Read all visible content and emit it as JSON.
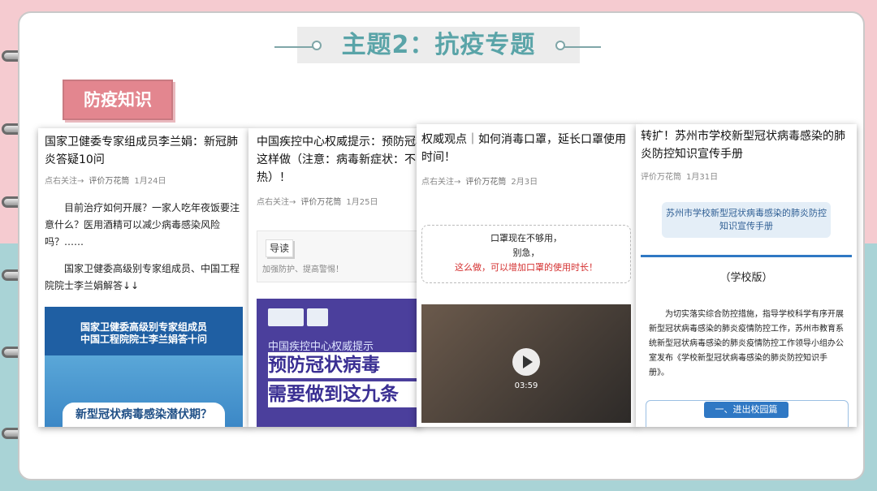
{
  "slide": {
    "title": "主题2：抗疫专题",
    "section_tag": "防疫知识"
  },
  "articles": [
    {
      "title": "国家卫健委专家组成员李兰娟：新冠肺炎答疑10问",
      "follow": "点右关注→",
      "source": "评价万花筒",
      "date": "1月24日",
      "paragraph1": "目前治疗如何开展？一家人吃年夜饭要注意什么？医用酒精可以减少病毒感染风险吗？……",
      "paragraph2": "国家卫健委高级别专家组成员、中国工程院院士李兰娟解答↓↓",
      "banner_line1": "国家卫健委高级别专家组成员",
      "banner_line2": "中国工程院院士李兰娟答十问",
      "callout": "新型冠状病毒感染潜伏期？"
    },
    {
      "title": "中国疾控中心权威提示：预防冠状病毒这样做（注意：病毒新症状：不嗽发热）！",
      "follow": "点右关注→",
      "source": "评价万花筒",
      "date": "1月25日",
      "guide_label": "导读",
      "guide_text": "加强防护、提高警惕！",
      "poster_line1": "中国疾控中心权威提示",
      "poster_line2": "预防冠状病毒",
      "poster_line3": "需要做到这九条"
    },
    {
      "title": "权威观点｜如何消毒口罩，延长口罩使用时间！",
      "follow": "点右关注→",
      "source": "评价万花筒",
      "date": "2月3日",
      "box_line1": "口罩现在不够用，",
      "box_line2": "别急，",
      "box_line3": "这么做，可以增加口罩的使用时长！",
      "video_duration": "03:59"
    },
    {
      "title": "转扩！苏州市学校新型冠状病毒感染的肺炎防控知识宣传手册",
      "source": "评价万花筒",
      "date": "1月31日",
      "card_title": "苏州市学校新型冠状病毒感染的肺炎防控知识宣传手册",
      "edition": "（学校版）",
      "intro": "为切实落实综合防控措施，指导学校科学有序开展新型冠状病毒感染的肺炎疫情防控工作，苏州市教育系统新型冠状病毒感染的肺炎疫情防控工作领导小组办公室发布《学校新型冠状病毒感染的肺炎防控知识手册》。",
      "section_button": "一、进出校园篇"
    }
  ],
  "colors": {
    "pink_bg": "#f5cbd0",
    "teal_bg": "#a9d3d6",
    "title_teal": "#5aa4a8",
    "tag_pink": "#e3868f",
    "banner_blue": "#1f5fa3",
    "poster_purple": "#4b3f9c",
    "manual_blue": "#2f78c4"
  }
}
